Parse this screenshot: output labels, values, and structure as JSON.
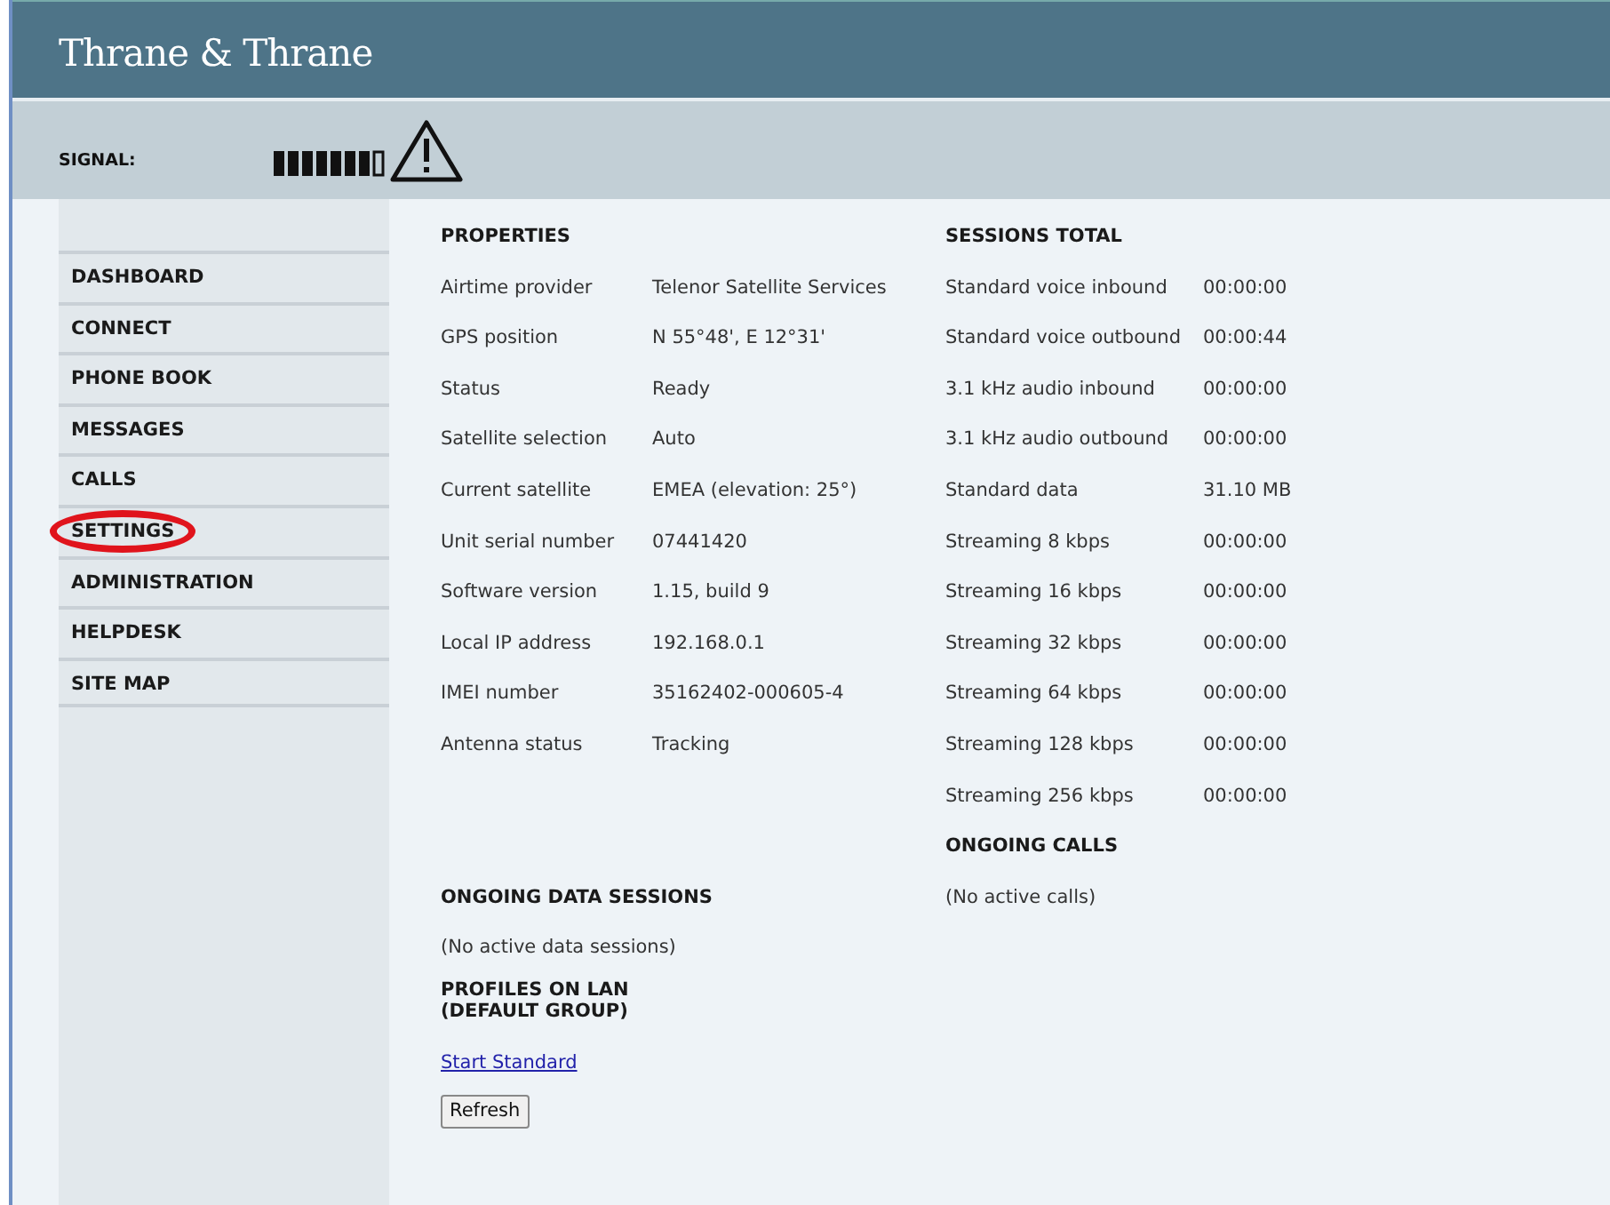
{
  "header": {
    "brand": "Thrane & Thrane"
  },
  "status_bar": {
    "signal_label": "SIGNAL:"
  },
  "sidebar": {
    "items": [
      {
        "label": "DASHBOARD",
        "circled": false
      },
      {
        "label": "CONNECT",
        "circled": false
      },
      {
        "label": "PHONE BOOK",
        "circled": false
      },
      {
        "label": "MESSAGES",
        "circled": false
      },
      {
        "label": "CALLS",
        "circled": false
      },
      {
        "label": "SETTINGS",
        "circled": true
      },
      {
        "label": "ADMINISTRATION",
        "circled": false
      },
      {
        "label": "HELPDESK",
        "circled": false
      },
      {
        "label": "SITE MAP",
        "circled": false
      }
    ]
  },
  "properties": {
    "title": "PROPERTIES",
    "rows": [
      {
        "label": "Airtime provider",
        "value": "Telenor Satellite Services"
      },
      {
        "label": "GPS position",
        "value": "N 55°48', E 12°31'"
      },
      {
        "label": "Status",
        "value": "Ready"
      },
      {
        "label": "Satellite selection",
        "value": "Auto"
      },
      {
        "label": "Current satellite",
        "value": "EMEA (elevation: 25°)"
      },
      {
        "label": "Unit serial number",
        "value": "07441420"
      },
      {
        "label": "Software version",
        "value": "1.15, build 9"
      },
      {
        "label": "Local IP address",
        "value": "192.168.0.1"
      },
      {
        "label": "IMEI number",
        "value": "35162402-000605-4"
      },
      {
        "label": "Antenna status",
        "value": "Tracking"
      }
    ]
  },
  "sessions_total": {
    "title": "SESSIONS TOTAL",
    "rows": [
      {
        "label": "Standard voice inbound",
        "value": "00:00:00"
      },
      {
        "label": "Standard voice outbound",
        "value": "00:00:44"
      },
      {
        "label": "3.1 kHz audio inbound",
        "value": "00:00:00"
      },
      {
        "label": "3.1 kHz audio outbound",
        "value": "00:00:00"
      },
      {
        "label": "Standard data",
        "value": "31.10 MB"
      },
      {
        "label": "Streaming 8 kbps",
        "value": "00:00:00"
      },
      {
        "label": "Streaming 16 kbps",
        "value": "00:00:00"
      },
      {
        "label": "Streaming 32 kbps",
        "value": "00:00:00"
      },
      {
        "label": "Streaming 64 kbps",
        "value": "00:00:00"
      },
      {
        "label": "Streaming 128 kbps",
        "value": "00:00:00"
      },
      {
        "label": "Streaming 256 kbps",
        "value": "00:00:00"
      }
    ]
  },
  "ongoing_data": {
    "title": "ONGOING DATA SESSIONS",
    "text": "(No active data sessions)"
  },
  "ongoing_calls": {
    "title": "ONGOING CALLS",
    "text": "(No active calls)"
  },
  "profiles": {
    "title_lines": [
      "PROFILES ON LAN",
      "(DEFAULT GROUP)"
    ],
    "link": "Start Standard"
  },
  "refresh_button": "Refresh"
}
